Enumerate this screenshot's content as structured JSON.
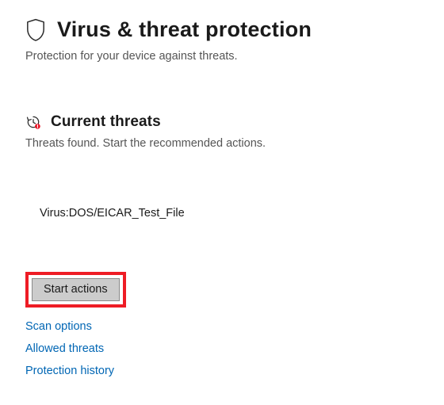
{
  "header": {
    "title": "Virus & threat protection",
    "subtitle": "Protection for your device against threats.",
    "icon": "shield-icon"
  },
  "section": {
    "title": "Current threats",
    "subtitle": "Threats found. Start the recommended actions.",
    "icon": "history-alert-icon"
  },
  "threats": [
    {
      "name": "Virus:DOS/EICAR_Test_File"
    }
  ],
  "actions": {
    "start_button_label": "Start actions"
  },
  "links": [
    {
      "id": "scan-options",
      "label": "Scan options"
    },
    {
      "id": "allowed-threats",
      "label": "Allowed threats"
    },
    {
      "id": "protection-history",
      "label": "Protection history"
    }
  ],
  "highlight_color": "#ee1c25"
}
